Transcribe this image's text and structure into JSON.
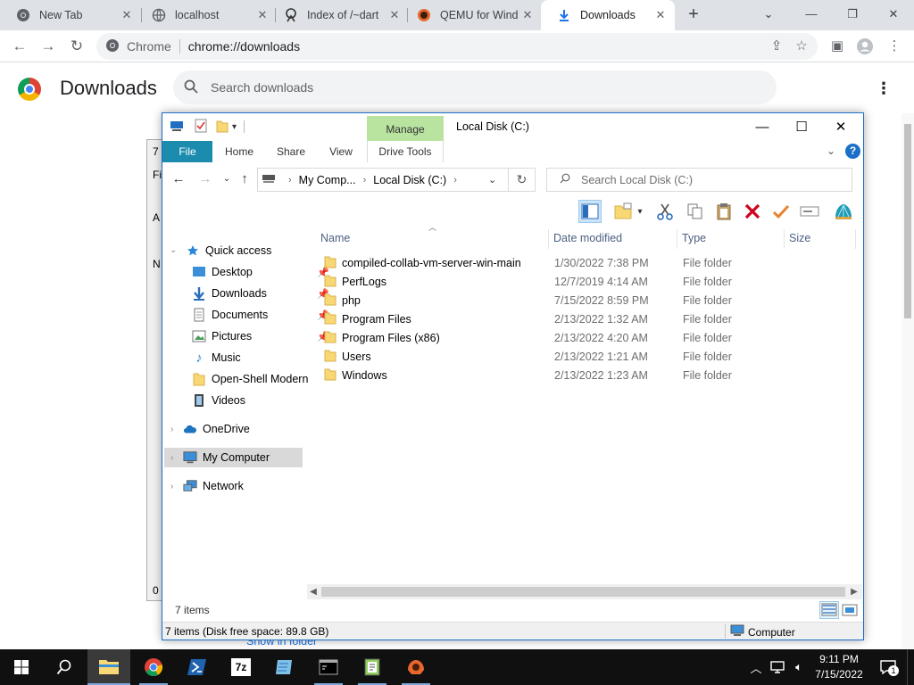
{
  "browser": {
    "tabs": [
      {
        "title": "New Tab",
        "icon": "chrome-icon",
        "active": false
      },
      {
        "title": "localhost",
        "icon": "globe-icon",
        "active": false
      },
      {
        "title": "Index of /~dart",
        "icon": "server-icon",
        "active": false
      },
      {
        "title": "QEMU for Wind",
        "icon": "qemu-icon",
        "active": false
      },
      {
        "title": "Downloads",
        "icon": "download-icon",
        "active": true
      }
    ],
    "omnibox": {
      "site": "Chrome",
      "url": "chrome://downloads"
    }
  },
  "downloads_page": {
    "title": "Downloads",
    "search_placeholder": "Search downloads",
    "show_in_folder": "Show in folder"
  },
  "background_window": {
    "fragments": [
      "7",
      "Fi",
      "A",
      "N",
      "0 /"
    ]
  },
  "explorer": {
    "title": "Local Disk (C:)",
    "contextual_tab_group": "Manage",
    "ribbon_tabs": [
      "File",
      "Home",
      "Share",
      "View",
      "Drive Tools"
    ],
    "address": {
      "parts": [
        "My Comp...",
        "Local Disk (C:)"
      ]
    },
    "search_placeholder": "Search Local Disk (C:)",
    "nav": {
      "quick_access": "Quick access",
      "quick_items": [
        "Desktop",
        "Downloads",
        "Documents",
        "Pictures",
        "Music",
        "Open-Shell Modern",
        "Videos"
      ],
      "onedrive": "OneDrive",
      "my_computer": "My Computer",
      "network": "Network"
    },
    "columns": [
      "Name",
      "Date modified",
      "Type",
      "Size"
    ],
    "files": [
      {
        "name": "compiled-collab-vm-server-win-main",
        "date": "1/30/2022 7:38 PM",
        "type": "File folder"
      },
      {
        "name": "PerfLogs",
        "date": "12/7/2019 4:14 AM",
        "type": "File folder"
      },
      {
        "name": "php",
        "date": "7/15/2022 8:59 PM",
        "type": "File folder"
      },
      {
        "name": "Program Files",
        "date": "2/13/2022 1:32 AM",
        "type": "File folder"
      },
      {
        "name": "Program Files (x86)",
        "date": "2/13/2022 4:20 AM",
        "type": "File folder"
      },
      {
        "name": "Users",
        "date": "2/13/2022 1:21 AM",
        "type": "File folder"
      },
      {
        "name": "Windows",
        "date": "2/13/2022 1:23 AM",
        "type": "File folder"
      }
    ],
    "item_count": "7 items",
    "status_left": "7 items (Disk free space: 89.8 GB)",
    "status_right": "Computer"
  },
  "taskbar": {
    "clock_time": "9:11 PM",
    "clock_date": "7/15/2022",
    "notification_count": "1",
    "apps": [
      "start-icon",
      "search-icon",
      "file-explorer-icon",
      "chrome-icon",
      "powershell-icon",
      "7zip-icon",
      "notepad-icon",
      "terminal-icon",
      "app-icon",
      "qemu-icon"
    ]
  },
  "colors": {
    "chrome_tabstrip": "#dee1e6",
    "explorer_file_tab": "#1b8bae",
    "manage_tab": "#b9e4a0",
    "folder_yellow": "#f8d775",
    "taskbar": "#101010"
  }
}
